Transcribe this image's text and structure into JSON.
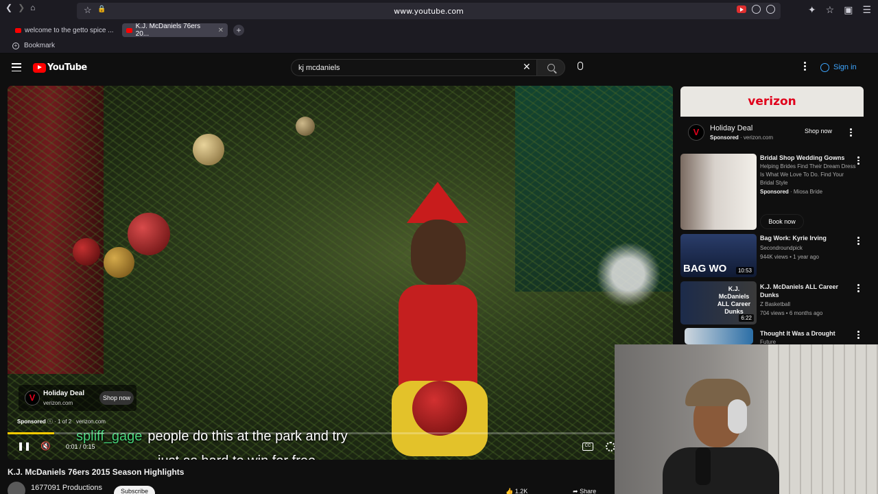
{
  "browser": {
    "address": "www.youtube.com",
    "tabs": [
      {
        "title": "welcome to the getto spice ..."
      },
      {
        "title": "K.J. McDaniels 76ers 20...",
        "active": true
      }
    ],
    "bookmark_label": "Bookmark"
  },
  "yt": {
    "logo_text": "YouTube",
    "search_query": "kj mcdaniels",
    "sign_in": "Sign in"
  },
  "player": {
    "ad": {
      "title": "Holiday Deal",
      "domain": "verizon.com",
      "cta": "Shop now",
      "sponsored": "Sponsored",
      "count": "1 of 2",
      "domain2": "verizon.com"
    },
    "caption": {
      "username": "spliff_gage",
      "line1": "people do this at the park and try",
      "line2": "just as hard to win for free."
    },
    "time": "0:01 / 0:15",
    "progress": 0.07
  },
  "video": {
    "title": "K.J. McDaniels 76ers 2015 Season Highlights",
    "channel": "1677091 Productions",
    "subscribe": "Subscribe",
    "likes": "1.2K",
    "share": "Share"
  },
  "sidebar": {
    "banner": "verizon",
    "ad": {
      "title": "Holiday Deal",
      "sponsored": "Sponsored",
      "domain": "verizon.com",
      "cta": "Shop now"
    },
    "recs": [
      {
        "title": "Bridal Shop Wedding Gowns",
        "desc": "Helping Brides Find Their Dream Dress Is What We Love To Do. Find Your Bridal Style",
        "sponsored": "Sponsored",
        "advertiser": "Miosa Bride",
        "cta": "Book now"
      },
      {
        "title": "Bag Work: Kyrie Irving",
        "channel": "Secondroundpick",
        "meta": "944K views • 1 year ago",
        "duration": "10:53",
        "thumb_text": "BAG WO"
      },
      {
        "title": "K.J. McDaniels ALL Career Dunks",
        "channel": "Z Basketball",
        "meta": "704 views • 6 months ago",
        "duration": "6:22",
        "thumb_text": "K.J. McDaniels ALL Career Dunks"
      },
      {
        "title": "Thought It Was a Drought",
        "channel": "Future"
      }
    ]
  },
  "colors": {
    "youtube_red": "#ff0000",
    "verizon_red": "#e0001b",
    "signin_blue": "#3ea6ff",
    "caption_name": "#47d47a",
    "progress": "#ffcc00"
  }
}
